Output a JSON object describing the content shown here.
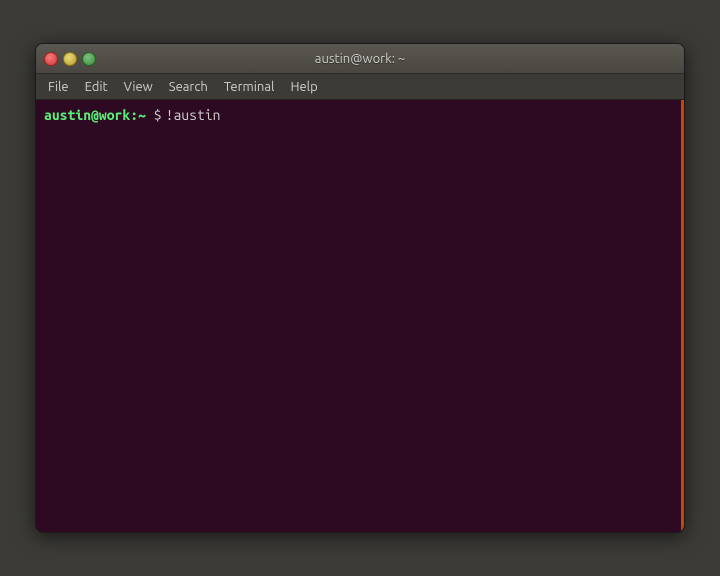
{
  "window": {
    "title": "austin@work: ~",
    "controls": {
      "close_label": "×",
      "minimize_label": "–",
      "maximize_label": "□"
    }
  },
  "menubar": {
    "items": [
      {
        "id": "file",
        "label": "File"
      },
      {
        "id": "edit",
        "label": "Edit"
      },
      {
        "id": "view",
        "label": "View"
      },
      {
        "id": "search",
        "label": "Search"
      },
      {
        "id": "terminal",
        "label": "Terminal"
      },
      {
        "id": "help",
        "label": "Help"
      }
    ]
  },
  "terminal": {
    "prompt_user": "austin@work:",
    "prompt_path": "~",
    "prompt_symbol": "$",
    "command": "!austin"
  }
}
